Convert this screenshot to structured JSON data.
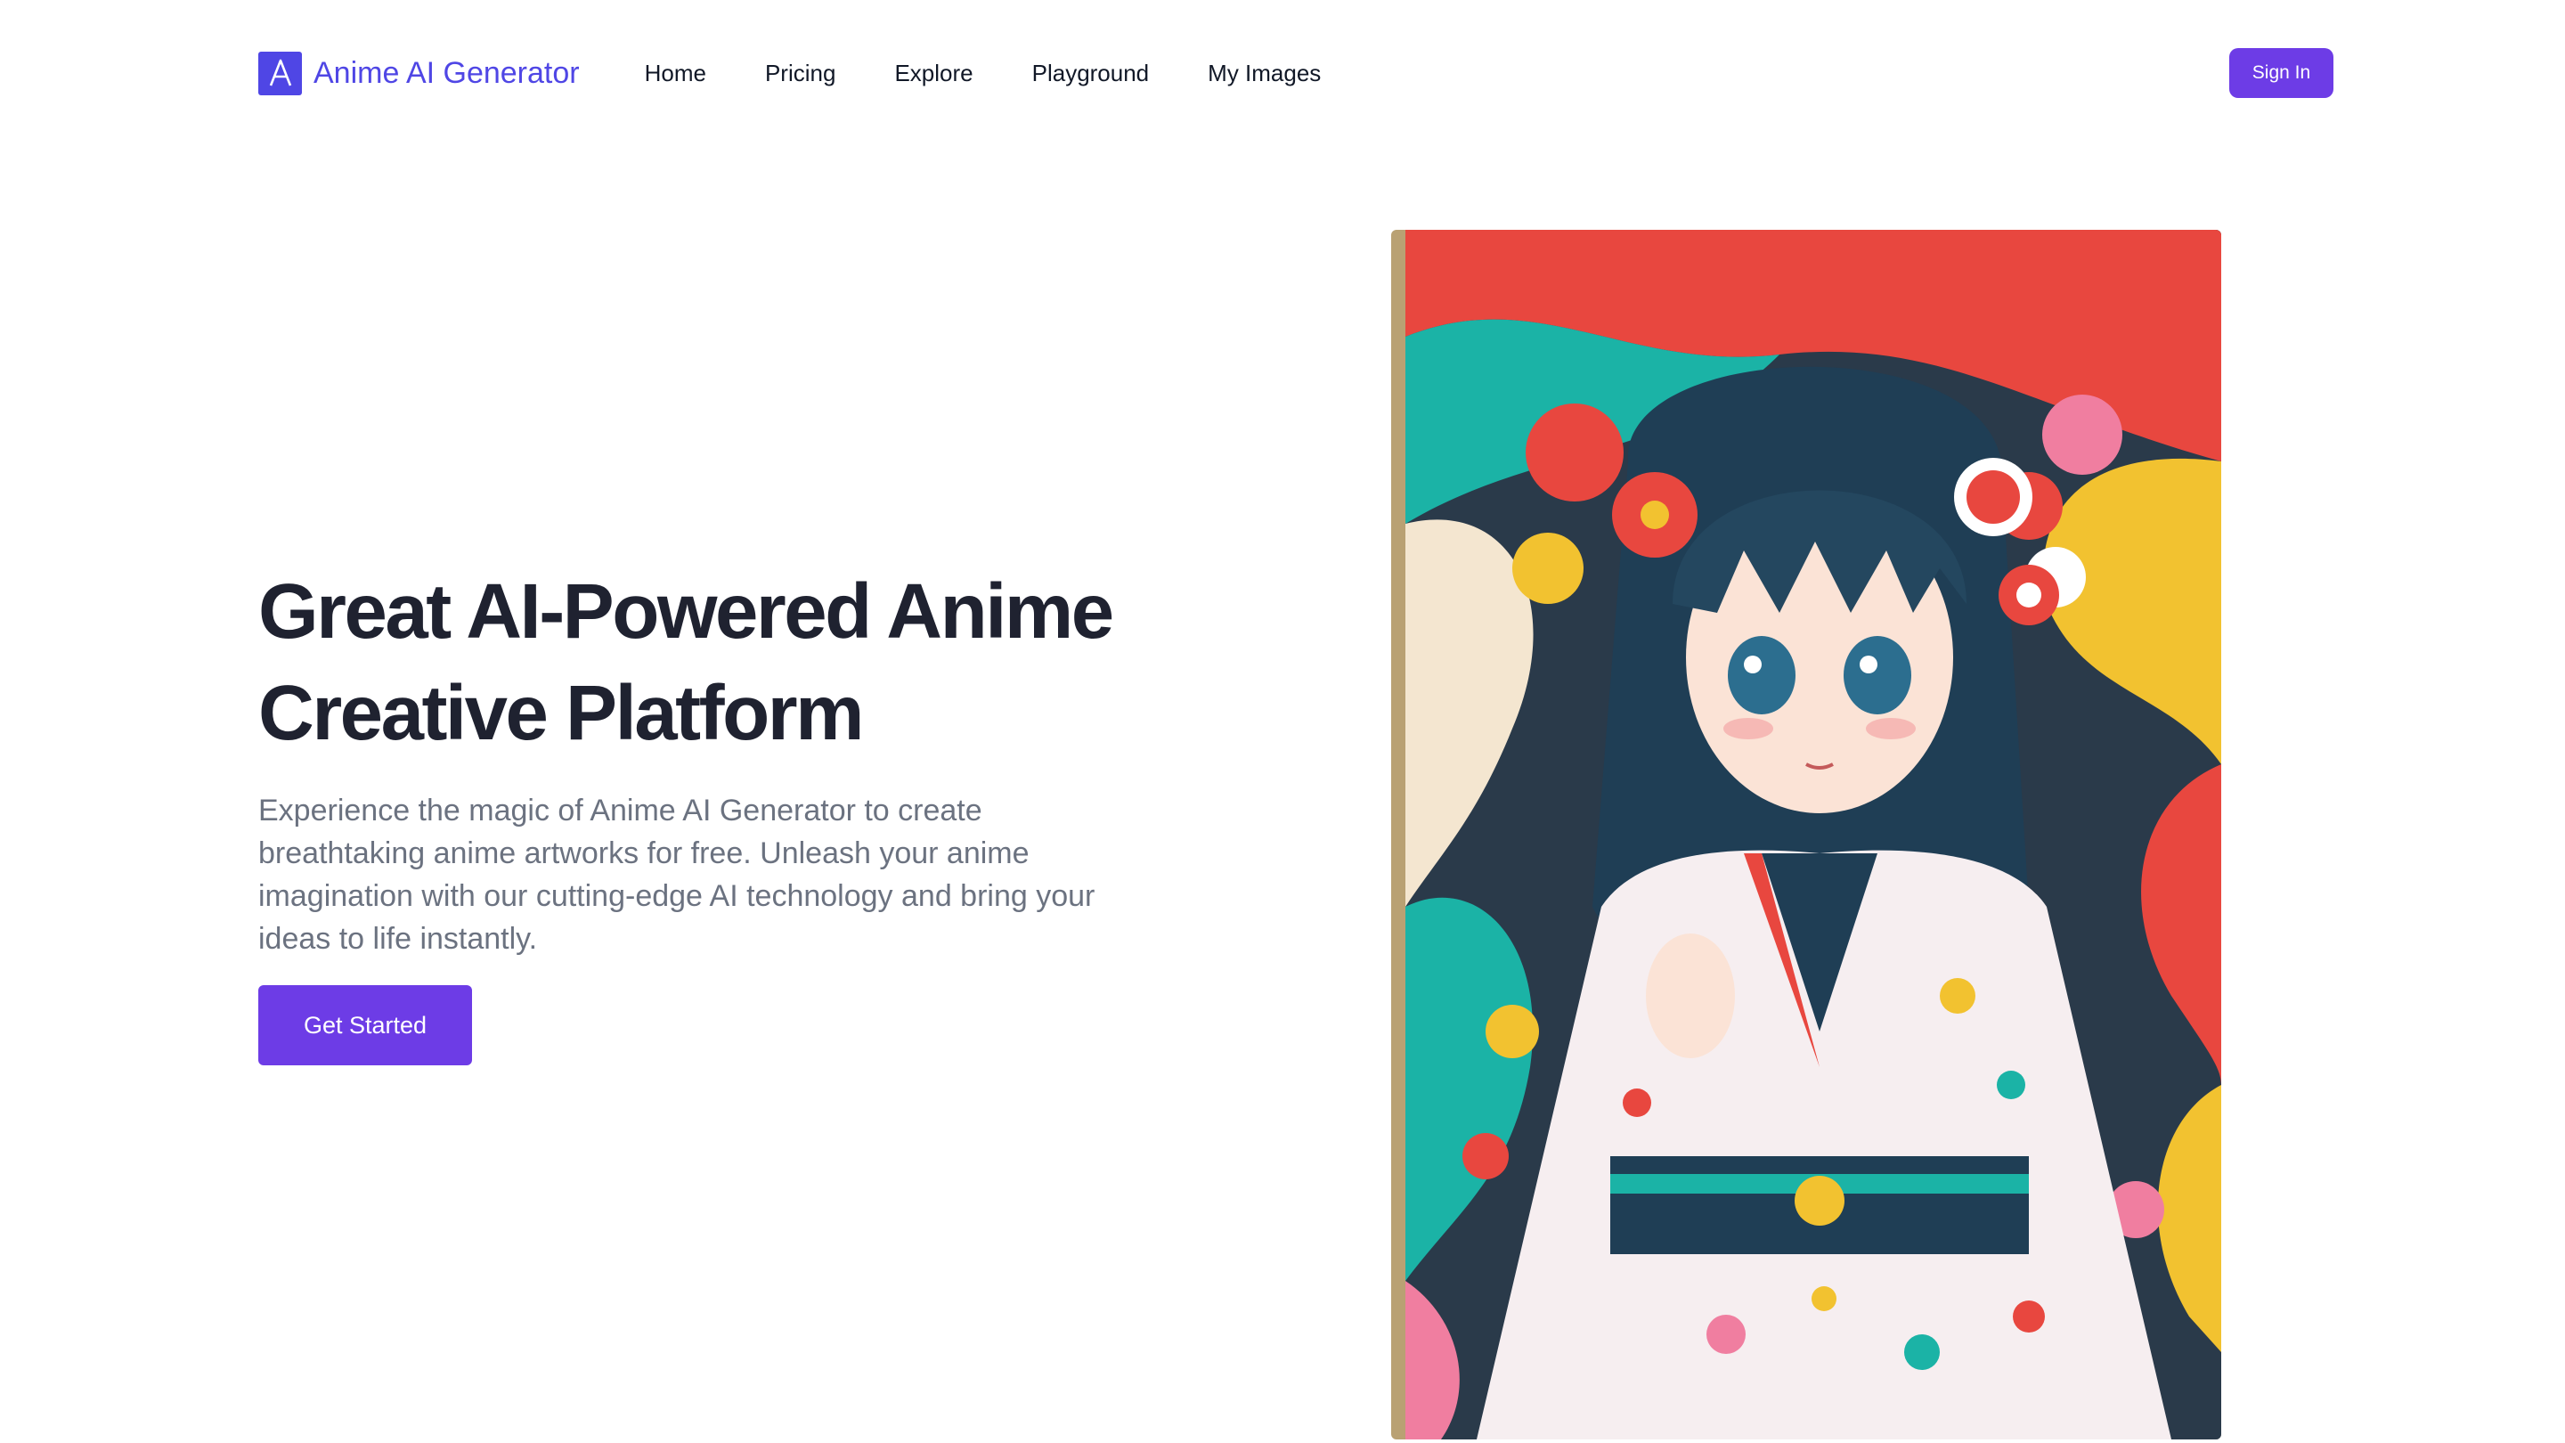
{
  "brand": {
    "name": "Anime AI Generator",
    "logo_icon": "letter-a-logo-icon",
    "color": "#4f46e5"
  },
  "nav": {
    "items": [
      {
        "label": "Home"
      },
      {
        "label": "Pricing"
      },
      {
        "label": "Explore"
      },
      {
        "label": "Playground"
      },
      {
        "label": "My Images"
      }
    ],
    "sign_in_label": "Sign In"
  },
  "hero": {
    "title_line1": "Great AI-Powered Anime",
    "title_line2": "Creative Platform",
    "description": "Experience the magic of Anime AI Generator to create breathtaking anime artworks for free. Unleash your anime imagination with our cutting-edge AI technology and bring your ideas to life instantly.",
    "cta_label": "Get Started"
  },
  "colors": {
    "accent": "#6d3ce6",
    "heading": "#1f2230",
    "body_text": "#6b7280"
  }
}
